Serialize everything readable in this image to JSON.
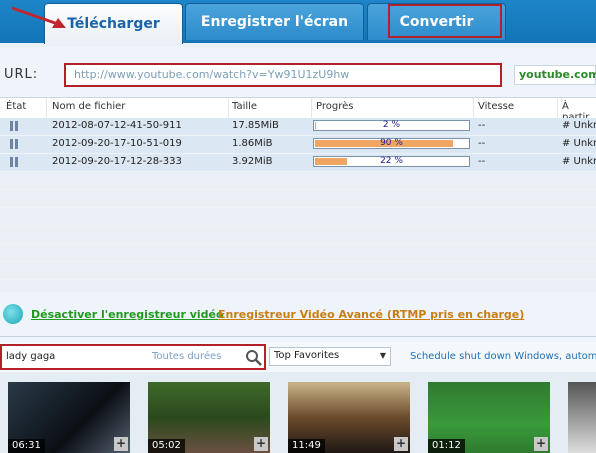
{
  "tabs": [
    {
      "label": "Télécharger"
    },
    {
      "label": "Enregistrer l'écran"
    },
    {
      "label": "Convertir"
    }
  ],
  "url": {
    "label": "URL:",
    "value": "http://www.youtube.com/watch?v=Yw91U1zU9hw",
    "site": "youtube.com"
  },
  "table": {
    "headers": [
      "État",
      "Nom de fichier",
      "Taille",
      "Progrès",
      "Vitesse",
      "À partir"
    ],
    "rows": [
      {
        "status_icon": "pause-icon",
        "name": "2012-08-07-12-41-50-911",
        "size": "17.85MiB",
        "progress": 2,
        "progress_label": "2 %",
        "speed": "--",
        "from": "# Unkn"
      },
      {
        "status_icon": "pause-icon",
        "name": "2012-09-20-17-10-51-019",
        "size": "1.86MiB",
        "progress": 90,
        "progress_label": "90 %",
        "speed": "--",
        "from": "# Unkn"
      },
      {
        "status_icon": "pause-icon",
        "name": "2012-09-20-17-12-28-333",
        "size": "3.92MiB",
        "progress": 22,
        "progress_label": "22 %",
        "speed": "--",
        "from": "# Unkn"
      }
    ]
  },
  "links": {
    "disable_recorder": "Désactiver l'enregistreur vidéo",
    "advanced_recorder": "Enregistreur Vidéo Avancé (RTMP pris en charge)"
  },
  "search": {
    "query": "lady gaga",
    "duration": "Toutes durées",
    "category": "Top Favorites",
    "schedule": "Schedule shut down Windows, automa"
  },
  "thumbnails": [
    {
      "duration": "06:31"
    },
    {
      "duration": "05:02"
    },
    {
      "duration": "11:49"
    },
    {
      "duration": "01:12"
    },
    {
      "duration": ""
    }
  ],
  "colors": {
    "tab_bar": "#1273b4",
    "highlight": "#b3202a",
    "progress_fill": "#f0a663",
    "link_green": "#1f9a1f",
    "link_orange": "#c97e12"
  }
}
